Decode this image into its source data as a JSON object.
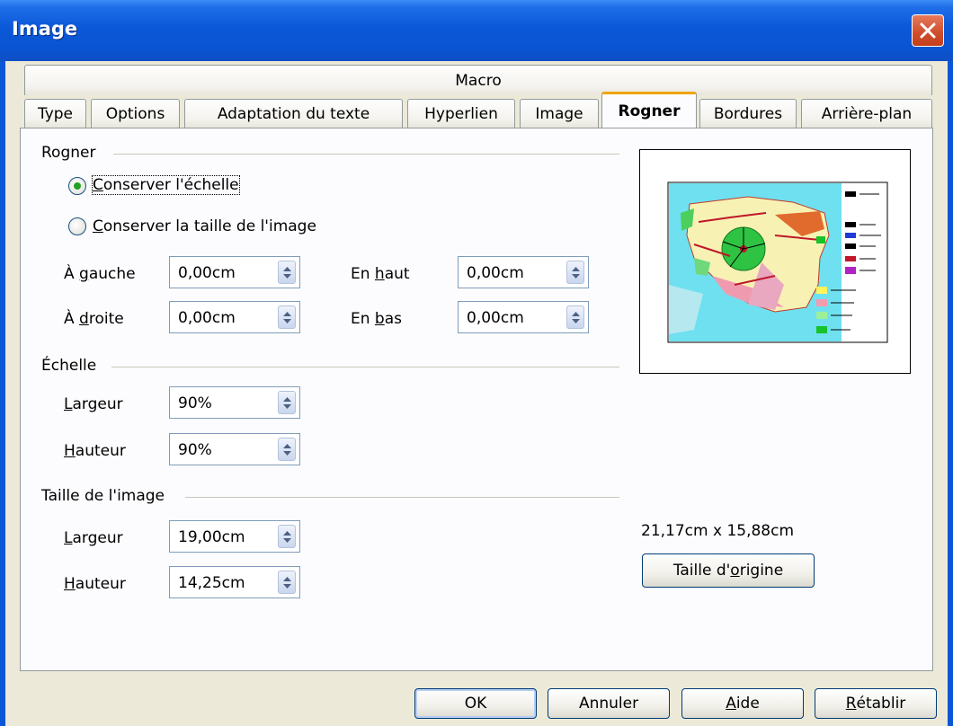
{
  "window": {
    "title": "Image",
    "close_icon": "close-icon"
  },
  "tabs_row1": [
    {
      "label": "Macro"
    }
  ],
  "tabs_row2": [
    {
      "label": "Type"
    },
    {
      "label": "Options"
    },
    {
      "label": "Adaptation du texte"
    },
    {
      "label": "Hyperlien"
    },
    {
      "label": "Image"
    },
    {
      "label": "Rogner",
      "active": true
    },
    {
      "label": "Bordures"
    },
    {
      "label": "Arrière-plan"
    }
  ],
  "crop": {
    "section_label": "Rogner",
    "keep_scale": {
      "pre": "",
      "key": "C",
      "post": "onserver l'échelle",
      "selected": true
    },
    "keep_size": {
      "pre": "",
      "key": "C",
      "post": "onserver la taille de l'image",
      "selected": false
    },
    "left": {
      "pre": "À ",
      "key": "g",
      "post": "auche",
      "value": "0,00cm"
    },
    "right": {
      "pre": "À ",
      "key": "d",
      "post": "roite",
      "value": "0,00cm"
    },
    "top": {
      "pre": "En ",
      "key": "h",
      "post": "aut",
      "value": "0,00cm"
    },
    "bottom": {
      "pre": "En ",
      "key": "b",
      "post": "as",
      "value": "0,00cm"
    }
  },
  "scale": {
    "section_label": "Échelle",
    "width": {
      "pre": "",
      "key": "L",
      "post": "argeur",
      "value": "90%"
    },
    "height": {
      "pre": "",
      "key": "H",
      "post": "auteur",
      "value": "90%"
    }
  },
  "image_size": {
    "section_label": "Taille de l'image",
    "width": {
      "pre": "",
      "key": "L",
      "post": "argeur",
      "value": "19,00cm"
    },
    "height": {
      "pre": "",
      "key": "H",
      "post": "auteur",
      "value": "14,25cm"
    }
  },
  "original_size": {
    "dimensions": "21,17cm x 15,88cm",
    "button": {
      "pre": "Taille d'",
      "key": "o",
      "post": "rigine"
    }
  },
  "buttons": {
    "ok": {
      "pre": "OK",
      "key": "",
      "post": ""
    },
    "cancel": {
      "pre": "Annuler",
      "key": "",
      "post": ""
    },
    "help": {
      "pre": "",
      "key": "A",
      "post": "ide"
    },
    "reset": {
      "pre": "",
      "key": "R",
      "post": "établir"
    }
  },
  "colors": {
    "accent_tab": "#f0a400",
    "titlebar": "#0a54d2",
    "radio_dot": "#21a121"
  }
}
